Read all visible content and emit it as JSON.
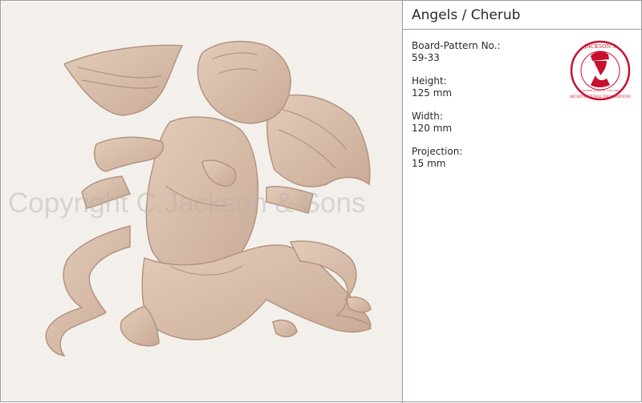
{
  "image": {
    "watermark": "Copyright C.Jackson & Sons",
    "subject_icon": "cherub-relief-image"
  },
  "header": {
    "title": "Angels / Cherub"
  },
  "specs": [
    {
      "label": "Board-Pattern No.:",
      "value": "59-33"
    },
    {
      "label": "Height:",
      "value": "125 mm"
    },
    {
      "label": "Width:",
      "value": "120 mm"
    },
    {
      "label": "Projection:",
      "value": "15 mm"
    }
  ],
  "logo": {
    "icon": "jacksons-seal-logo",
    "text": "JACKSON'S ARCHITECTURAL DECORATIONS GEORGE JACKSON 1756-1840"
  },
  "colors": {
    "relief": "#d8bda8",
    "relief_shadow": "#b89a86",
    "seal": "#c8102e",
    "border": "#9a9a9a"
  }
}
